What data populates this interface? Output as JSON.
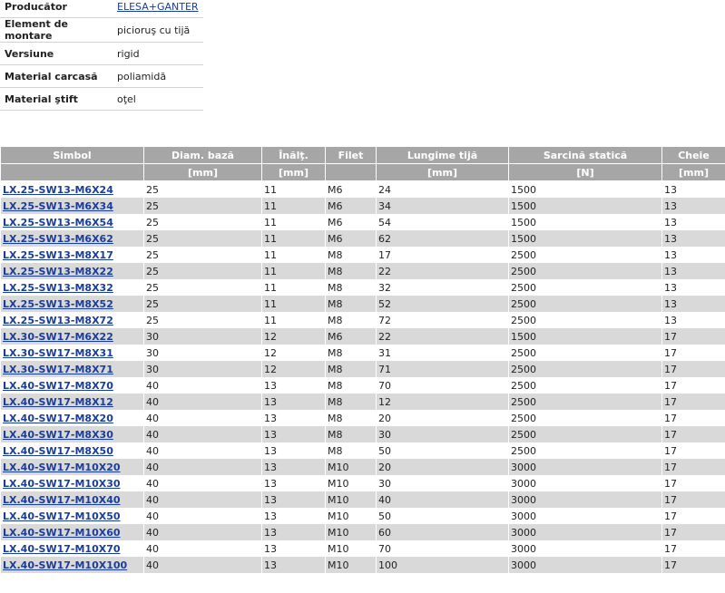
{
  "properties": [
    {
      "label": "Producător",
      "value": "ELESA+GANTER",
      "link": true
    },
    {
      "label": "Element de montare",
      "value": "picioruş cu tijă",
      "link": false
    },
    {
      "label": "Versiune",
      "value": "rigid",
      "link": false
    },
    {
      "label": "Material carcasă",
      "value": "poliamidă",
      "link": false
    },
    {
      "label": "Material ştift",
      "value": "oţel",
      "link": false
    }
  ],
  "table": {
    "headers": [
      "Simbol",
      "Diam. bază",
      "Înălţ.",
      "Filet",
      "Lungime tijă",
      "Sarcină statică",
      "Cheie"
    ],
    "units": [
      "",
      "[mm]",
      "[mm]",
      "",
      "[mm]",
      "[N]",
      "[mm]"
    ],
    "rows": [
      [
        "LX.25-SW13-M6X24",
        "25",
        "11",
        "M6",
        "24",
        "1500",
        "13"
      ],
      [
        "LX.25-SW13-M6X34",
        "25",
        "11",
        "M6",
        "34",
        "1500",
        "13"
      ],
      [
        "LX.25-SW13-M6X54",
        "25",
        "11",
        "M6",
        "54",
        "1500",
        "13"
      ],
      [
        "LX.25-SW13-M6X62",
        "25",
        "11",
        "M6",
        "62",
        "1500",
        "13"
      ],
      [
        "LX.25-SW13-M8X17",
        "25",
        "11",
        "M8",
        "17",
        "2500",
        "13"
      ],
      [
        "LX.25-SW13-M8X22",
        "25",
        "11",
        "M8",
        "22",
        "2500",
        "13"
      ],
      [
        "LX.25-SW13-M8X32",
        "25",
        "11",
        "M8",
        "32",
        "2500",
        "13"
      ],
      [
        "LX.25-SW13-M8X52",
        "25",
        "11",
        "M8",
        "52",
        "2500",
        "13"
      ],
      [
        "LX.25-SW13-M8X72",
        "25",
        "11",
        "M8",
        "72",
        "2500",
        "13"
      ],
      [
        "LX.30-SW17-M6X22",
        "30",
        "12",
        "M6",
        "22",
        "1500",
        "17"
      ],
      [
        "LX.30-SW17-M8X31",
        "30",
        "12",
        "M8",
        "31",
        "2500",
        "17"
      ],
      [
        "LX.30-SW17-M8X71",
        "30",
        "12",
        "M8",
        "71",
        "2500",
        "17"
      ],
      [
        "LX.40-SW17-M8X70",
        "40",
        "13",
        "M8",
        "70",
        "2500",
        "17"
      ],
      [
        "LX.40-SW17-M8X12",
        "40",
        "13",
        "M8",
        "12",
        "2500",
        "17"
      ],
      [
        "LX.40-SW17-M8X20",
        "40",
        "13",
        "M8",
        "20",
        "2500",
        "17"
      ],
      [
        "LX.40-SW17-M8X30",
        "40",
        "13",
        "M8",
        "30",
        "2500",
        "17"
      ],
      [
        "LX.40-SW17-M8X50",
        "40",
        "13",
        "M8",
        "50",
        "2500",
        "17"
      ],
      [
        "LX.40-SW17-M10X20",
        "40",
        "13",
        "M10",
        "20",
        "3000",
        "17"
      ],
      [
        "LX.40-SW17-M10X30",
        "40",
        "13",
        "M10",
        "30",
        "3000",
        "17"
      ],
      [
        "LX.40-SW17-M10X40",
        "40",
        "13",
        "M10",
        "40",
        "3000",
        "17"
      ],
      [
        "LX.40-SW17-M10X50",
        "40",
        "13",
        "M10",
        "50",
        "3000",
        "17"
      ],
      [
        "LX.40-SW17-M10X60",
        "40",
        "13",
        "M10",
        "60",
        "3000",
        "17"
      ],
      [
        "LX.40-SW17-M10X70",
        "40",
        "13",
        "M10",
        "70",
        "3000",
        "17"
      ],
      [
        "LX.40-SW17-M10X100",
        "40",
        "13",
        "M10",
        "100",
        "3000",
        "17"
      ]
    ]
  },
  "colors": {
    "link": "#1a3d9c",
    "header_bg": "#a6a6a6",
    "row_alt_bg": "#d9d9d9"
  }
}
